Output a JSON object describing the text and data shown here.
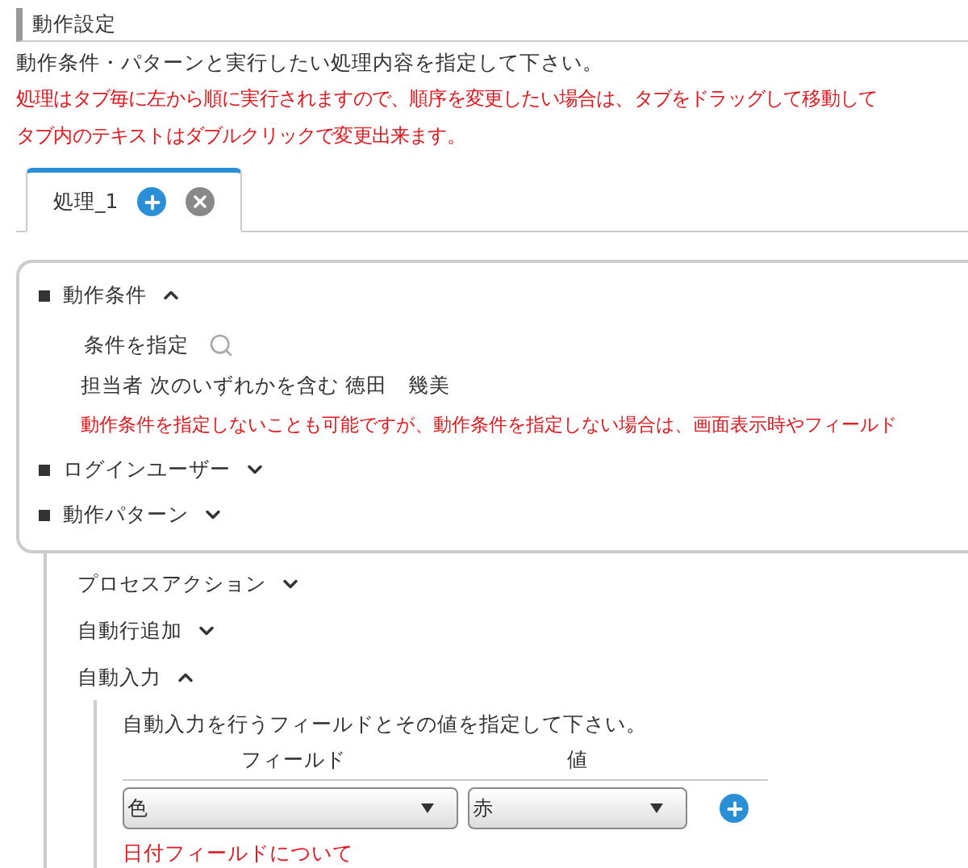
{
  "header": {
    "title": "動作設定"
  },
  "description": "動作条件・パターンと実行したい処理内容を指定して下さい。",
  "notes": [
    "処理はタブ毎に左から順に実行されますので、順序を変更したい場合は、タブをドラッグして移動して",
    "タブ内のテキストはダブルクリックで変更出来ます。"
  ],
  "tabs": [
    {
      "label": "処理_1",
      "selected": true
    }
  ],
  "conditions_panel": {
    "sections": [
      {
        "label": "動作条件",
        "expanded": true,
        "condition_label": "条件を指定",
        "condition": "担当者 次のいずれかを含む 徳田　幾美",
        "warning": "動作条件を指定しないことも可能ですが、動作条件を指定しない場合は、画面表示時やフィールド"
      },
      {
        "label": "ログインユーザー",
        "expanded": false
      },
      {
        "label": "動作パターン",
        "expanded": false
      }
    ]
  },
  "actions": [
    {
      "label": "プロセスアクション",
      "expanded": false
    },
    {
      "label": "自動行追加",
      "expanded": false
    },
    {
      "label": "自動入力",
      "expanded": true,
      "instruction": "自動入力を行うフィールドとその値を指定して下さい。",
      "columns": [
        "フィールド",
        "値"
      ],
      "rows": [
        {
          "field": "色",
          "value": "赤"
        }
      ],
      "note": "日付フィールドについて"
    }
  ]
}
